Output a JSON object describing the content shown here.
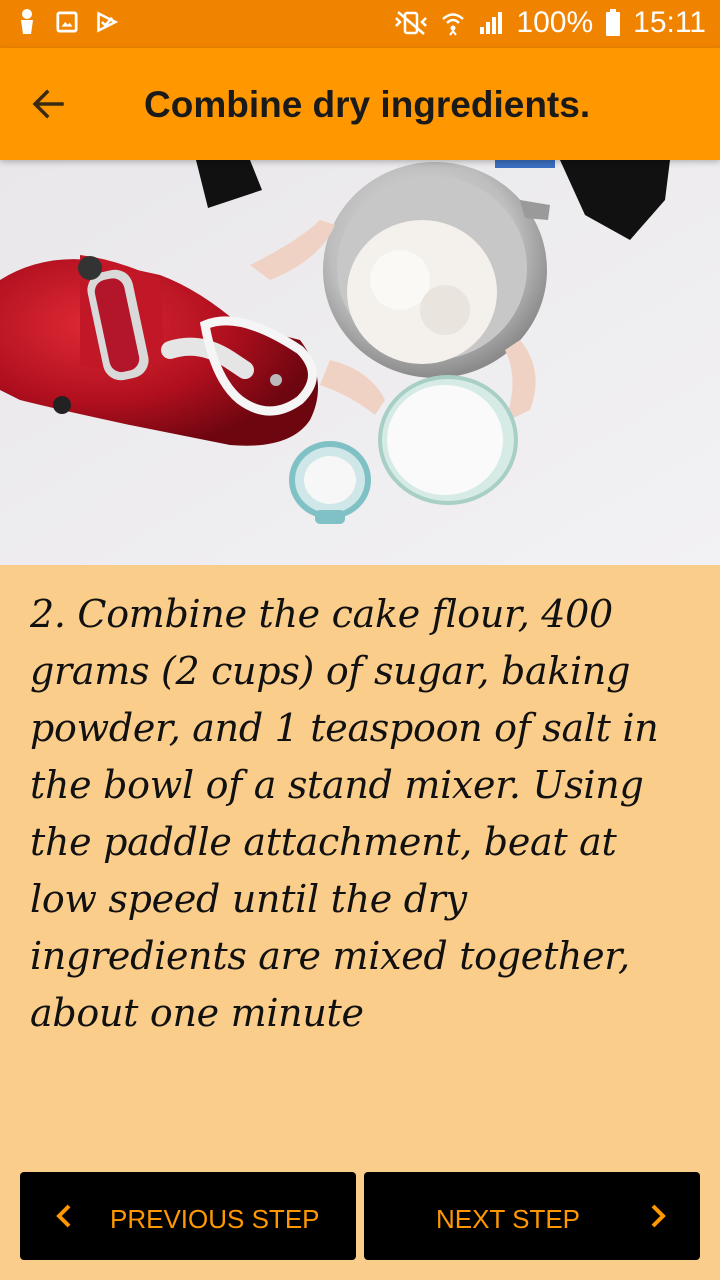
{
  "status_bar": {
    "battery": "100%",
    "time": "15:11",
    "left_icons": [
      "person-icon",
      "image-icon",
      "check-icon"
    ],
    "right_icons": [
      "vibrate-icon",
      "wifi-icon",
      "signal-icon",
      "battery-icon"
    ]
  },
  "app_bar": {
    "title": "Combine dry ingredients.",
    "back_icon": "arrow-back-icon",
    "color": "#ff9800"
  },
  "hero_image": {
    "subject": "stand mixer with bowls of flour and sugar"
  },
  "step": {
    "text": "2. Combine the cake flour, 400 grams (2 cups) of sugar, baking powder, and 1 teaspoon of salt in the bowl of a stand mixer. Using the paddle attachment, beat at low speed until the dry ingredients are mixed together, about one minute"
  },
  "navigation": {
    "previous_label": "PREVIOUS STEP",
    "next_label": "NEXT STEP",
    "accent": "#ff9800"
  },
  "colors": {
    "status_bar": "#f08400",
    "background": "#fbcd8a",
    "button": "#000000"
  }
}
